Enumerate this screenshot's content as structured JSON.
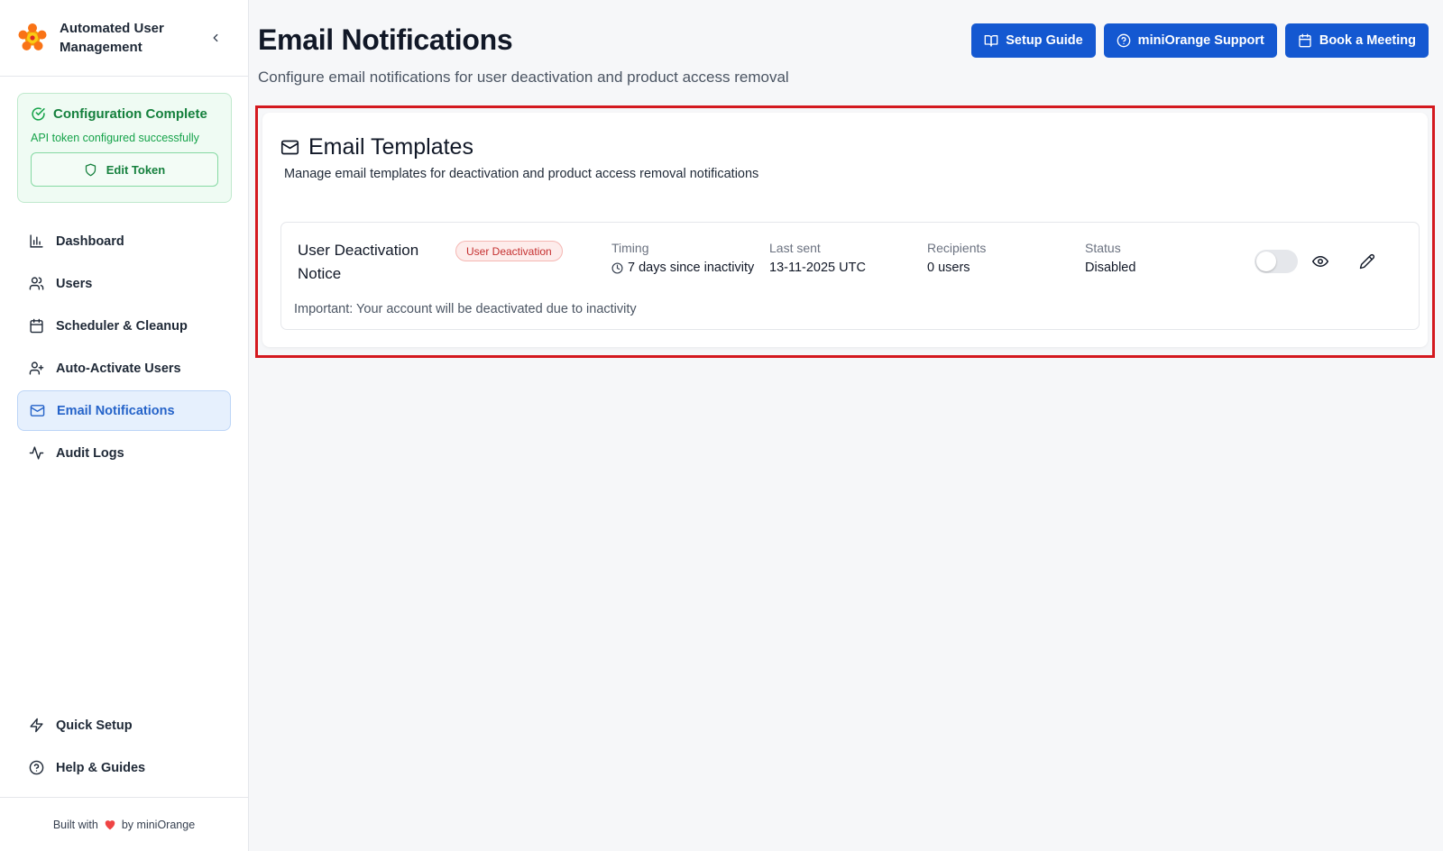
{
  "sidebar": {
    "app_title": "Automated User Management",
    "config": {
      "title": "Configuration Complete",
      "subtitle": "API token configured successfully",
      "edit_token_label": "Edit Token"
    },
    "nav": [
      {
        "label": "Dashboard",
        "icon": "bar-chart-icon"
      },
      {
        "label": "Users",
        "icon": "users-icon"
      },
      {
        "label": "Scheduler & Cleanup",
        "icon": "calendar-icon"
      },
      {
        "label": "Auto-Activate Users",
        "icon": "user-plus-icon"
      },
      {
        "label": "Email Notifications",
        "icon": "mail-icon",
        "active": true
      },
      {
        "label": "Audit Logs",
        "icon": "activity-icon"
      }
    ],
    "bottom_nav": [
      {
        "label": "Quick Setup",
        "icon": "lightning-icon"
      },
      {
        "label": "Help & Guides",
        "icon": "help-circle-icon"
      }
    ],
    "footer": {
      "prefix": "Built with",
      "suffix": "by miniOrange"
    }
  },
  "header": {
    "title": "Email Notifications",
    "subtitle": "Configure email notifications for user deactivation and product access removal",
    "buttons": {
      "setup_guide": "Setup Guide",
      "support": "miniOrange Support",
      "meeting": "Book a Meeting"
    }
  },
  "templates_card": {
    "title": "Email Templates",
    "subtitle": "Manage email templates for deactivation and product access removal notifications",
    "items": [
      {
        "name": "User Deactivation Notice",
        "badge": "User Deactivation",
        "timing_label": "Timing",
        "timing_value": "7 days since inactivity",
        "last_sent_label": "Last sent",
        "last_sent_value": "13-11-2025 UTC",
        "recipients_label": "Recipients",
        "recipients_value": "0 users",
        "status_label": "Status",
        "status_value": "Disabled",
        "description": "Important: Your account will be deactivated due to inactivity",
        "enabled": false
      }
    ]
  },
  "colors": {
    "primary_button": "#1458d1",
    "highlight_border": "#d4191f",
    "success_green": "#15803d",
    "active_nav_bg": "#e6f0fd",
    "badge_red": "#c53030"
  }
}
